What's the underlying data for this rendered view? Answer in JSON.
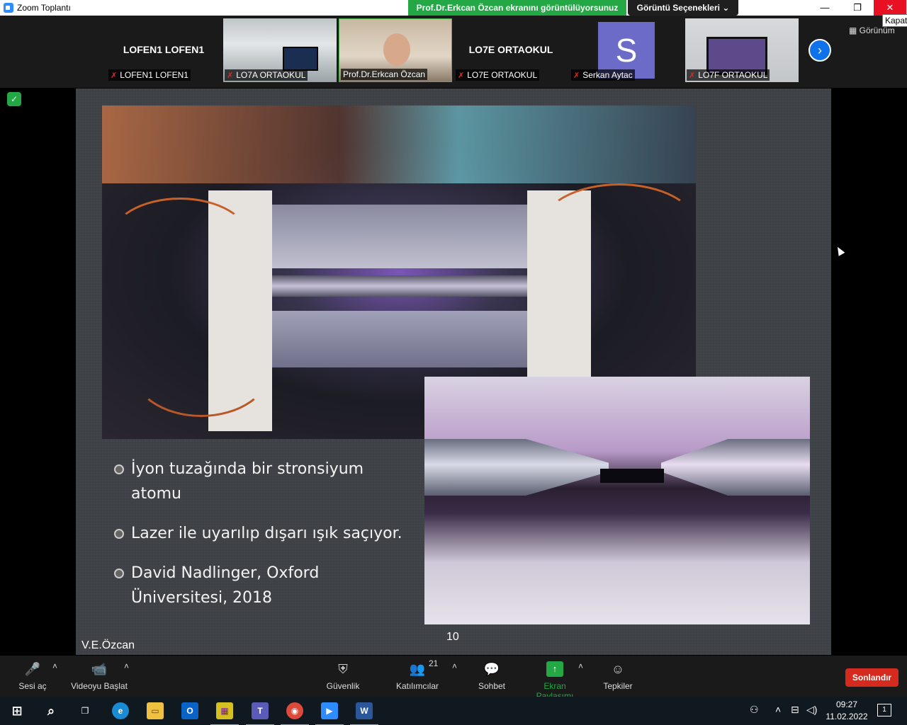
{
  "window": {
    "title": "Zoom Toplantı",
    "share_banner": "Prof.Dr.Erkcan Özcan ekranını görüntülüyorsunuz",
    "view_options": "Görüntü Seçenekleri",
    "view_options_caret": "⌄",
    "minimize": "—",
    "restore": "❐",
    "close": "✕",
    "close_tooltip": "Kapat"
  },
  "participants": {
    "tiles": [
      {
        "big": "LOFEN1 LOFEN1",
        "caption": "LOFEN1 LOFEN1",
        "muted": true
      },
      {
        "big": "",
        "caption": "LO7A ORTAOKUL",
        "muted": true
      },
      {
        "big": "",
        "caption": "Prof.Dr.Erkcan Özcan",
        "muted": false
      },
      {
        "big": "LO7E ORTAOKUL",
        "caption": "LO7E ORTAOKUL",
        "muted": true
      },
      {
        "big": "S",
        "caption": "Serkan Aytac",
        "muted": true
      },
      {
        "big": "",
        "caption": "LO7F ORTAOKUL",
        "muted": true
      }
    ],
    "muted_glyph": "✗",
    "next_arrow": "›",
    "gallery_view": "Görünüm"
  },
  "security_badge": "✓",
  "slide": {
    "bullets": [
      "İyon tuzağında bir stronsiyum atomu",
      "Lazer ile uyarılıp dışarı ışık saçıyor.",
      "David Nadlinger, Oxford Üniversitesi, 2018"
    ],
    "page_number": "10",
    "author": "V.E.Özcan"
  },
  "toolbar": {
    "unmute_label": "Sesi aç",
    "unmute_icon": "🎤",
    "start_video_label": "Videoyu Başlat",
    "start_video_icon": "📹",
    "security_label": "Güvenlik",
    "security_icon": "⛨",
    "participants_label": "Katılımcılar",
    "participants_icon": "👥",
    "participants_count": "21",
    "chat_label": "Sohbet",
    "chat_icon": "💬",
    "share_label": "Ekran Paylaşımı",
    "share_icon": "↑",
    "reactions_label": "Tepkiler",
    "reactions_icon": "☺",
    "caret": "˄",
    "end_label": "Sonlandır"
  },
  "taskbar": {
    "icons": [
      "start",
      "search",
      "task-view",
      "edge",
      "file-explorer",
      "outlook",
      "microsoft-365",
      "teams",
      "chrome",
      "zoom",
      "word"
    ],
    "glyphs": {
      "start": "⊞",
      "search": "⌕",
      "task_view": "❐",
      "edge": "e",
      "explorer": "▭",
      "outlook": "O",
      "office": "▦",
      "teams": "T",
      "chrome": "◉",
      "zoom": "▶",
      "word": "W"
    },
    "tray_glyphs": {
      "people": "⚇",
      "chevron": "˄",
      "network": "⊟",
      "volume": "◁)"
    },
    "time": "09:27",
    "date": "11.02.2022",
    "notifications": "1"
  },
  "colors": {
    "accent_green": "#23a845",
    "zoom_blue": "#0e72ed",
    "end_red": "#d52b1e"
  }
}
